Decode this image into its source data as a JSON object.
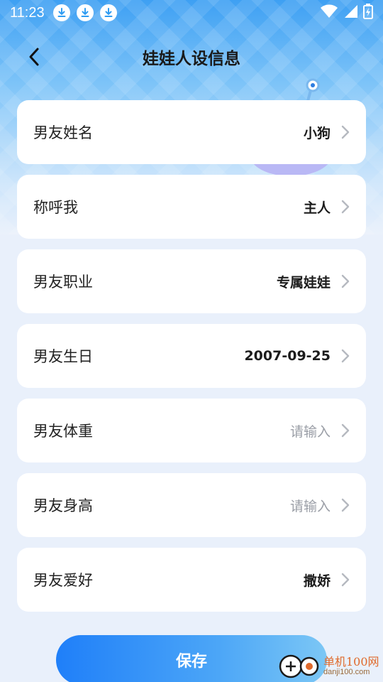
{
  "status_bar": {
    "time": "11:23",
    "notification_icons": [
      "download-icon",
      "download-icon",
      "download-icon"
    ],
    "right_icons": [
      "wifi-icon",
      "signal-icon",
      "battery-icon"
    ]
  },
  "header": {
    "back_icon": "chevron-left-icon",
    "title": "娃娃人设信息"
  },
  "rows": [
    {
      "label": "男友姓名",
      "value": "小狗",
      "placeholder": false
    },
    {
      "label": "称呼我",
      "value": "主人",
      "placeholder": false
    },
    {
      "label": "男友职业",
      "value": "专属娃娃",
      "placeholder": false
    },
    {
      "label": "男友生日",
      "value": "2007-09-25",
      "placeholder": false
    },
    {
      "label": "男友体重",
      "value": "请输入",
      "placeholder": true
    },
    {
      "label": "男友身高",
      "value": "请输入",
      "placeholder": true
    },
    {
      "label": "男友爱好",
      "value": "撒娇",
      "placeholder": false
    }
  ],
  "save_button": {
    "label": "保存"
  },
  "watermark": {
    "main": "单机100网",
    "sub": "danji100.com"
  },
  "colors": {
    "accent": "#1f7ff9",
    "header_top": "#3ea0f3",
    "page_bg": "#e9f0fb",
    "placeholder_text": "#9a9ea6",
    "watermark": "#e06a2c"
  }
}
